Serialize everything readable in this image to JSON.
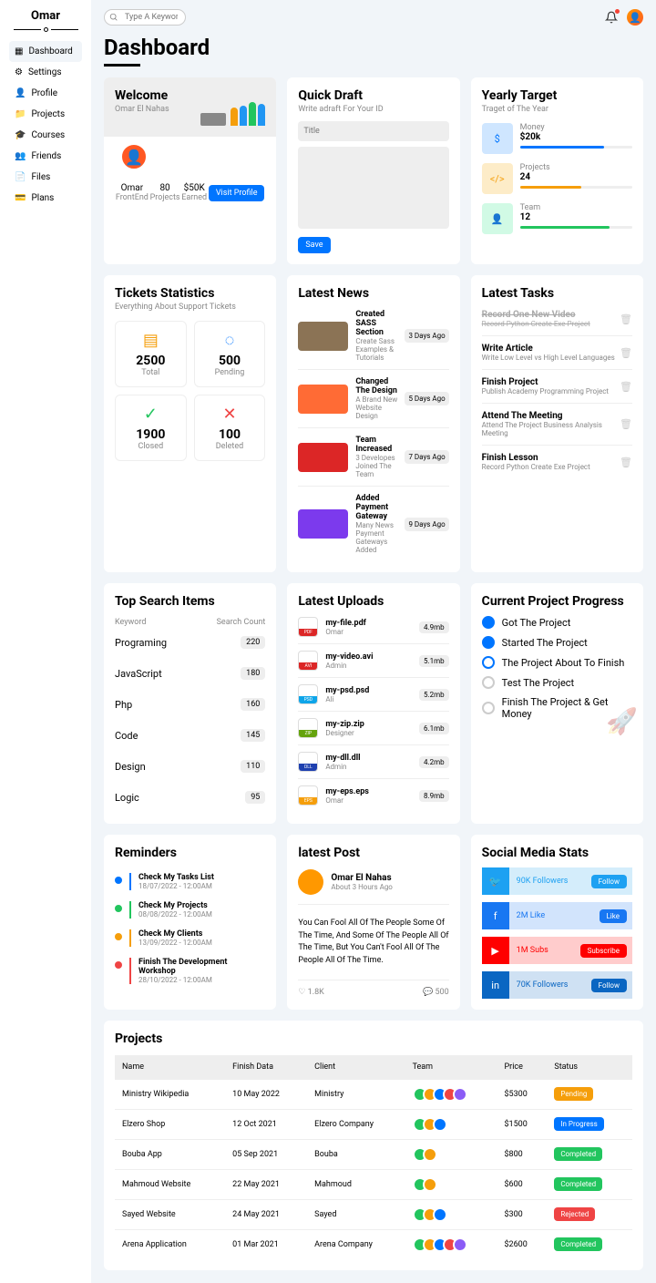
{
  "sidebar": {
    "title": "Omar",
    "items": [
      {
        "label": "Dashboard"
      },
      {
        "label": "Settings"
      },
      {
        "label": "Profile"
      },
      {
        "label": "Projects"
      },
      {
        "label": "Courses"
      },
      {
        "label": "Friends"
      },
      {
        "label": "Files"
      },
      {
        "label": "Plans"
      }
    ]
  },
  "search": {
    "placeholder": "Type A Keyword"
  },
  "page_title": "Dashboard",
  "welcome": {
    "title": "Welcome",
    "subtitle": "Omar El Nahas",
    "stats": [
      {
        "val": "Omar",
        "lbl": "FrontEnd"
      },
      {
        "val": "80",
        "lbl": "Projects"
      },
      {
        "val": "$50K",
        "lbl": "Earned"
      }
    ],
    "btn": "Visit Profile"
  },
  "draft": {
    "title": "Quick Draft",
    "sub": "Write adraft For Your ID",
    "placeholder": "Title",
    "btn": "Save"
  },
  "targets": {
    "title": "Yearly Target",
    "sub": "Traget of The Year",
    "items": [
      {
        "lbl": "Money",
        "val": "$20k",
        "pct": 75,
        "color": "#0075ff",
        "bg": "#cfe6ff"
      },
      {
        "lbl": "Projects",
        "val": "24",
        "pct": 55,
        "color": "#f59e0b",
        "bg": "#fdecc8"
      },
      {
        "lbl": "Team",
        "val": "12",
        "pct": 80,
        "color": "#22c55e",
        "bg": "#d1fae5"
      }
    ]
  },
  "tickets": {
    "title": "Tickets Statistics",
    "sub": "Everything About Support Tickets",
    "items": [
      {
        "val": "2500",
        "lbl": "Total",
        "color": "#f59e0b"
      },
      {
        "val": "500",
        "lbl": "Pending",
        "color": "#0075ff"
      },
      {
        "val": "1900",
        "lbl": "Closed",
        "color": "#22c55e"
      },
      {
        "val": "100",
        "lbl": "Deleted",
        "color": "#ef4444"
      }
    ]
  },
  "news": {
    "title": "Latest News",
    "items": [
      {
        "title": "Created SASS Section",
        "text": "Create Sass Examples & Tutorials",
        "date": "3 Days Ago",
        "bg": "#8b7355"
      },
      {
        "title": "Changed The Design",
        "text": "A Brand New Website Design",
        "date": "5 Days Ago",
        "bg": "#ff6b35"
      },
      {
        "title": "Team Increased",
        "text": "3 Developes Joined The Team",
        "date": "7 Days Ago",
        "bg": "#dc2626"
      },
      {
        "title": "Added Payment Gateway",
        "text": "Many News Payment Gateways Added",
        "date": "9 Days Ago",
        "bg": "#7c3aed"
      }
    ]
  },
  "tasks": {
    "title": "Latest Tasks",
    "items": [
      {
        "title": "Record One New Video",
        "text": "Record Python Create Exe Project",
        "done": true
      },
      {
        "title": "Write Article",
        "text": "Write Low Level vs High Level Languages"
      },
      {
        "title": "Finish Project",
        "text": "Publish Academy Programming Project"
      },
      {
        "title": "Attend The Meeting",
        "text": "Attend The Project Business Analysis Meeting"
      },
      {
        "title": "Finish Lesson",
        "text": "Record Python Create Exe Project"
      }
    ]
  },
  "top_search": {
    "title": "Top Search Items",
    "h1": "Keyword",
    "h2": "Search Count",
    "items": [
      {
        "k": "Programing",
        "c": "220"
      },
      {
        "k": "JavaScript",
        "c": "180"
      },
      {
        "k": "Php",
        "c": "160"
      },
      {
        "k": "Code",
        "c": "145"
      },
      {
        "k": "Design",
        "c": "110"
      },
      {
        "k": "Logic",
        "c": "95"
      }
    ]
  },
  "uploads": {
    "title": "Latest Uploads",
    "items": [
      {
        "name": "my-file.pdf",
        "user": "Omar",
        "size": "4.9mb",
        "ext": "PDF",
        "color": "#dc2626"
      },
      {
        "name": "my-video.avi",
        "user": "Admin",
        "size": "5.1mb",
        "ext": "AVI",
        "color": "#dc2626"
      },
      {
        "name": "my-psd.psd",
        "user": "Ali",
        "size": "5.2mb",
        "ext": "PSD",
        "color": "#0ea5e9"
      },
      {
        "name": "my-zip.zip",
        "user": "Designer",
        "size": "6.1mb",
        "ext": "ZIP",
        "color": "#65a30d"
      },
      {
        "name": "my-dll.dll",
        "user": "Admin",
        "size": "4.2mb",
        "ext": "DLL",
        "color": "#1e40af"
      },
      {
        "name": "my-eps.eps",
        "user": "Omar",
        "size": "8.9mb",
        "ext": "EPS",
        "color": "#f59e0b"
      }
    ]
  },
  "progress": {
    "title": "Current Project Progress",
    "items": [
      {
        "text": "Got The Project",
        "state": "filled"
      },
      {
        "text": "Started The Project",
        "state": "filled"
      },
      {
        "text": "The Project About To Finish",
        "state": "ring"
      },
      {
        "text": "Test The Project",
        "state": "empty"
      },
      {
        "text": "Finish The Project & Get Money",
        "state": "empty"
      }
    ]
  },
  "reminders": {
    "title": "Reminders",
    "items": [
      {
        "title": "Check My Tasks List",
        "date": "18/07/2022 - 12:00AM",
        "color": "#0075ff"
      },
      {
        "title": "Check My Projects",
        "date": "08/08/2022 - 12:00AM",
        "color": "#22c55e"
      },
      {
        "title": "Check My Clients",
        "date": "13/09/2022 - 12:00AM",
        "color": "#f59e0b"
      },
      {
        "title": "Finish The Development Workshop",
        "date": "28/10/2022 - 12:00AM",
        "color": "#ef4444"
      }
    ]
  },
  "post": {
    "title": "latest Post",
    "author": "Omar El Nahas",
    "time": "About 3 Hours Ago",
    "body": "You Can Fool All Of The People Some Of The Time, And Some Of The People All Of The Time, But You Can't Fool All Of The People All Of The Time.",
    "likes": "1.8K",
    "comments": "500"
  },
  "social": {
    "title": "Social Media Stats",
    "items": [
      {
        "text": "90K Followers",
        "btn": "Follow",
        "color": "#1da1f2",
        "bg": "#d4edfb",
        "icon": "twitter"
      },
      {
        "text": "2M Like",
        "btn": "Like",
        "color": "#1877f2",
        "bg": "#d2e4fc",
        "icon": "facebook"
      },
      {
        "text": "1M Subs",
        "btn": "Subscribe",
        "color": "#ff0000",
        "bg": "#ffcccc",
        "icon": "youtube"
      },
      {
        "text": "70K Followers",
        "btn": "Follow",
        "color": "#0a66c2",
        "bg": "#cfe1f3",
        "icon": "linkedin"
      }
    ]
  },
  "projects": {
    "title": "Projects",
    "headers": [
      "Name",
      "Finish Data",
      "Client",
      "Team",
      "Price",
      "Status"
    ],
    "rows": [
      {
        "name": "Ministry Wikipedia",
        "date": "10 May 2022",
        "client": "Ministry",
        "team": 5,
        "price": "$5300",
        "status": "Pending",
        "sc": "#f59e0b"
      },
      {
        "name": "Elzero Shop",
        "date": "12 Oct 2021",
        "client": "Elzero Company",
        "team": 3,
        "price": "$1500",
        "status": "In Progress",
        "sc": "#0075ff"
      },
      {
        "name": "Bouba App",
        "date": "05 Sep 2021",
        "client": "Bouba",
        "team": 2,
        "price": "$800",
        "status": "Completed",
        "sc": "#22c55e"
      },
      {
        "name": "Mahmoud Website",
        "date": "22 May 2021",
        "client": "Mahmoud",
        "team": 2,
        "price": "$600",
        "status": "Completed",
        "sc": "#22c55e"
      },
      {
        "name": "Sayed Website",
        "date": "24 May 2021",
        "client": "Sayed",
        "team": 3,
        "price": "$300",
        "status": "Rejected",
        "sc": "#ef4444"
      },
      {
        "name": "Arena Application",
        "date": "01 Mar 2021",
        "client": "Arena Company",
        "team": 5,
        "price": "$2600",
        "status": "Completed",
        "sc": "#22c55e"
      }
    ]
  }
}
